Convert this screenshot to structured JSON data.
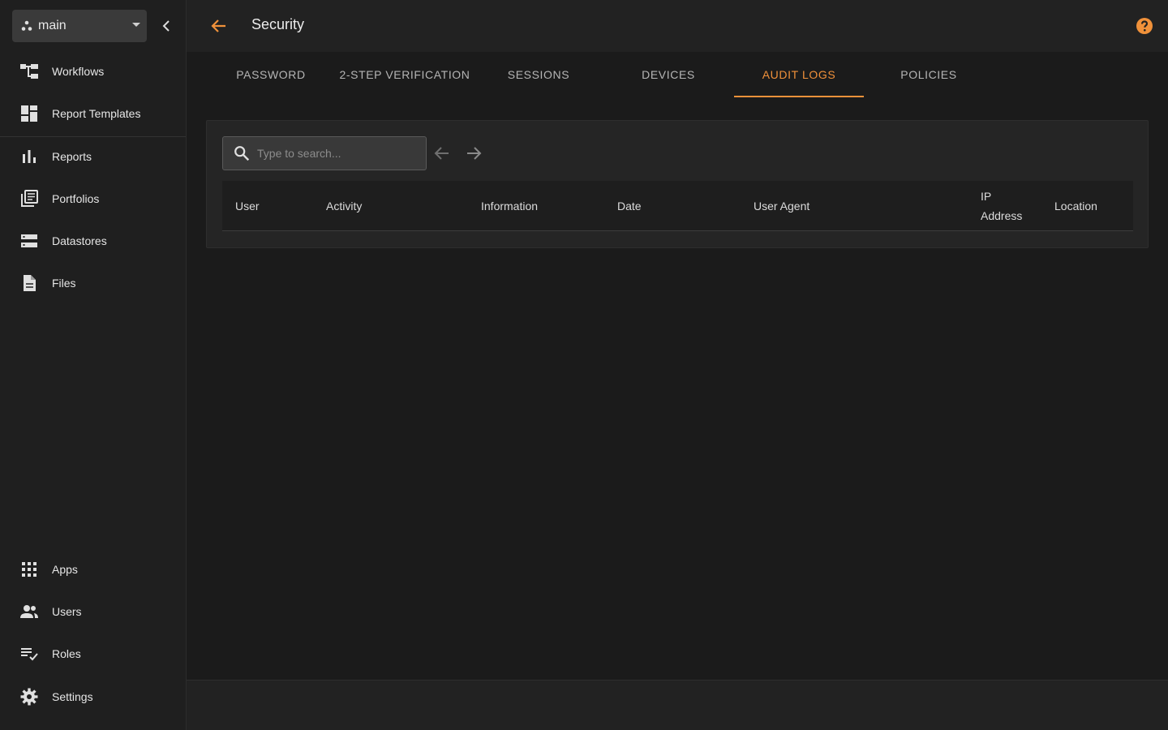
{
  "workspace": {
    "name": "main"
  },
  "sidebar": {
    "top_items": [
      {
        "label": "Workflows",
        "icon": "workflow-icon"
      },
      {
        "label": "Report Templates",
        "icon": "dashboard-icon"
      },
      {
        "label": "Reports",
        "icon": "bar-chart-icon"
      },
      {
        "label": "Portfolios",
        "icon": "library-icon"
      },
      {
        "label": "Datastores",
        "icon": "storage-icon"
      },
      {
        "label": "Files",
        "icon": "file-icon"
      }
    ],
    "bottom_items": [
      {
        "label": "Apps",
        "icon": "apps-grid-icon"
      },
      {
        "label": "Users",
        "icon": "users-icon"
      },
      {
        "label": "Roles",
        "icon": "checklist-icon"
      },
      {
        "label": "Settings",
        "icon": "gear-icon"
      }
    ]
  },
  "header": {
    "title": "Security"
  },
  "tabs": [
    {
      "label": "PASSWORD",
      "active": false
    },
    {
      "label": "2-STEP VERIFICATION",
      "active": false
    },
    {
      "label": "SESSIONS",
      "active": false
    },
    {
      "label": "DEVICES",
      "active": false
    },
    {
      "label": "AUDIT LOGS",
      "active": true
    },
    {
      "label": "POLICIES",
      "active": false
    }
  ],
  "audit": {
    "search_placeholder": "Type to search...",
    "columns": [
      "User",
      "Activity",
      "Information",
      "Date",
      "User Agent",
      "IP Address",
      "Location"
    ]
  },
  "colors": {
    "accent": "#f0913a",
    "background": "#1b1b1b",
    "sidebar": "#1f1f1f"
  }
}
